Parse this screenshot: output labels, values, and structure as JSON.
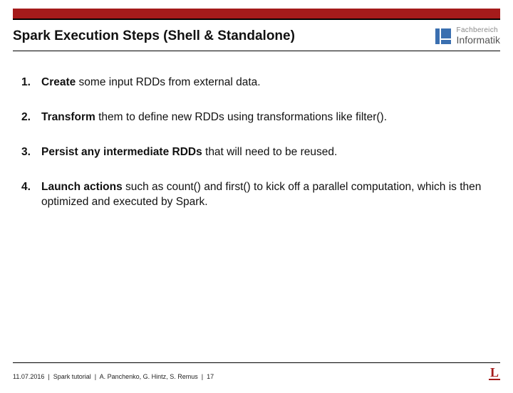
{
  "header": {
    "title": "Spark Execution Steps (Shell & Standalone)",
    "logo": {
      "line1": "Fachbereich",
      "line2": "Informatik"
    }
  },
  "steps": [
    {
      "n": "1.",
      "lead": "Create",
      "rest": " some input RDDs from external data."
    },
    {
      "n": "2.",
      "lead": "Transform",
      "rest": " them to define new RDDs using transformations like filter()."
    },
    {
      "n": "3.",
      "lead": "Persist any intermediate RDDs",
      "rest": " that will need to be reused."
    },
    {
      "n": "4.",
      "lead": "Launch actions",
      "rest": " such as count() and first() to kick off a parallel computation, which is then optimized and executed by Spark."
    }
  ],
  "footer": {
    "date": "11.07.2016",
    "course": "Spark tutorial",
    "authors": "A. Panchenko, G. Hintz, S. Remus",
    "page": "17",
    "corner": "L"
  }
}
